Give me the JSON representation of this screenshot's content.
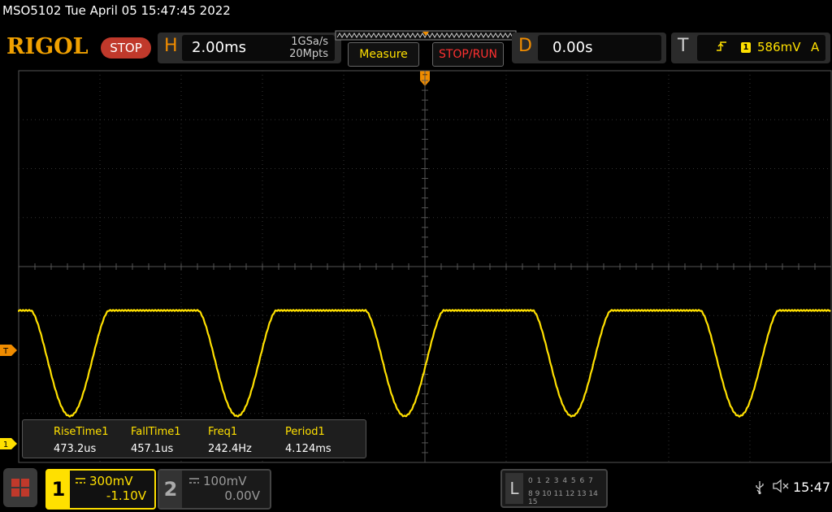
{
  "header": {
    "model_datetime": "MSO5102  Tue April 05 15:47:45 2022",
    "logo": "RIGOL",
    "run_state": "STOP"
  },
  "horizontal": {
    "letter": "H",
    "timebase": "2.00ms",
    "sample_rate": "1GSa/s",
    "memory_depth": "20Mpts"
  },
  "buttons": {
    "measure": "Measure",
    "stop_run": "STOP/RUN"
  },
  "delay": {
    "letter": "D",
    "value": "0.00s"
  },
  "trigger": {
    "letter": "T",
    "edge_icon": "rising-edge-icon",
    "source": "1",
    "level": "586mV",
    "mode": "A",
    "marker_label": "T"
  },
  "waveform": {
    "color": "#ffe000",
    "shape": "periodic-dips"
  },
  "measurements": {
    "headers": [
      "RiseTime1",
      "FallTime1",
      "Freq1",
      "Period1"
    ],
    "values": [
      "473.2us",
      "457.1us",
      "242.4Hz",
      "4.124ms"
    ]
  },
  "channels": {
    "ch1": {
      "number": "1",
      "scale": "300mV",
      "offset": "-1.10V",
      "marker_label": "1",
      "color": "#ffe000"
    },
    "ch2": {
      "number": "2",
      "scale": "100mV",
      "offset": "0.00V"
    }
  },
  "logic": {
    "letter": "L",
    "row1": "0 1 2 3   4 5 6 7",
    "row2": "8 9 10 11 12 13 14 15"
  },
  "status": {
    "time": "15:47",
    "usb_icon": "usb-icon",
    "speaker_icon": "speaker-muted-icon"
  }
}
